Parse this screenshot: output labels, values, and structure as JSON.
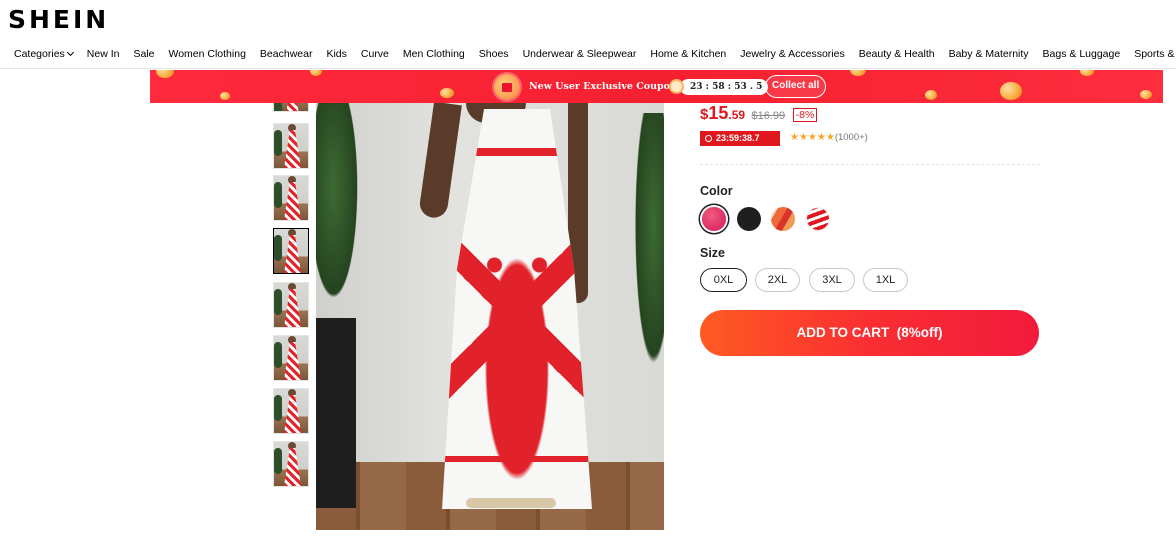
{
  "header": {
    "logo": "SHEIN",
    "nav": [
      "Categories",
      "New In",
      "Sale",
      "Women Clothing",
      "Beachwear",
      "Kids",
      "Curve",
      "Men Clothing",
      "Shoes",
      "Underwear & Sleepwear",
      "Home & Kitchen",
      "Jewelry & Accessories",
      "Beauty & Health",
      "Baby & Maternity",
      "Bags & Luggage",
      "Sports & Outdoors"
    ]
  },
  "promo": {
    "title": "New User Exclusive Coupons",
    "timer": "23 : 58 : 53 . 5",
    "collect_label": "Collect all"
  },
  "gallery": {
    "thumbnail_count": 8,
    "active_index": 3
  },
  "product": {
    "currency": "$",
    "price_main": "15",
    "price_cents": ".59",
    "original_price": "$16.99",
    "discount": "-8%",
    "flash_timer": "23:59:38.7",
    "stars": "★★★★★",
    "rating_count": "(1000+)",
    "rating_value": 4.5
  },
  "options": {
    "color_label": "Color",
    "colors": [
      "pink-pattern",
      "black",
      "orange-pattern",
      "red-white-pattern"
    ],
    "selected_color": 0,
    "size_label": "Size",
    "sizes": [
      "0XL",
      "2XL",
      "3XL",
      "1XL"
    ],
    "selected_size": 0
  },
  "cart": {
    "add_label": "ADD TO CART",
    "add_discount": "(8%off)"
  },
  "colors": {
    "brand_red": "#e1161f",
    "cta_start": "#fe5b22",
    "cta_end": "#f21a3c"
  }
}
